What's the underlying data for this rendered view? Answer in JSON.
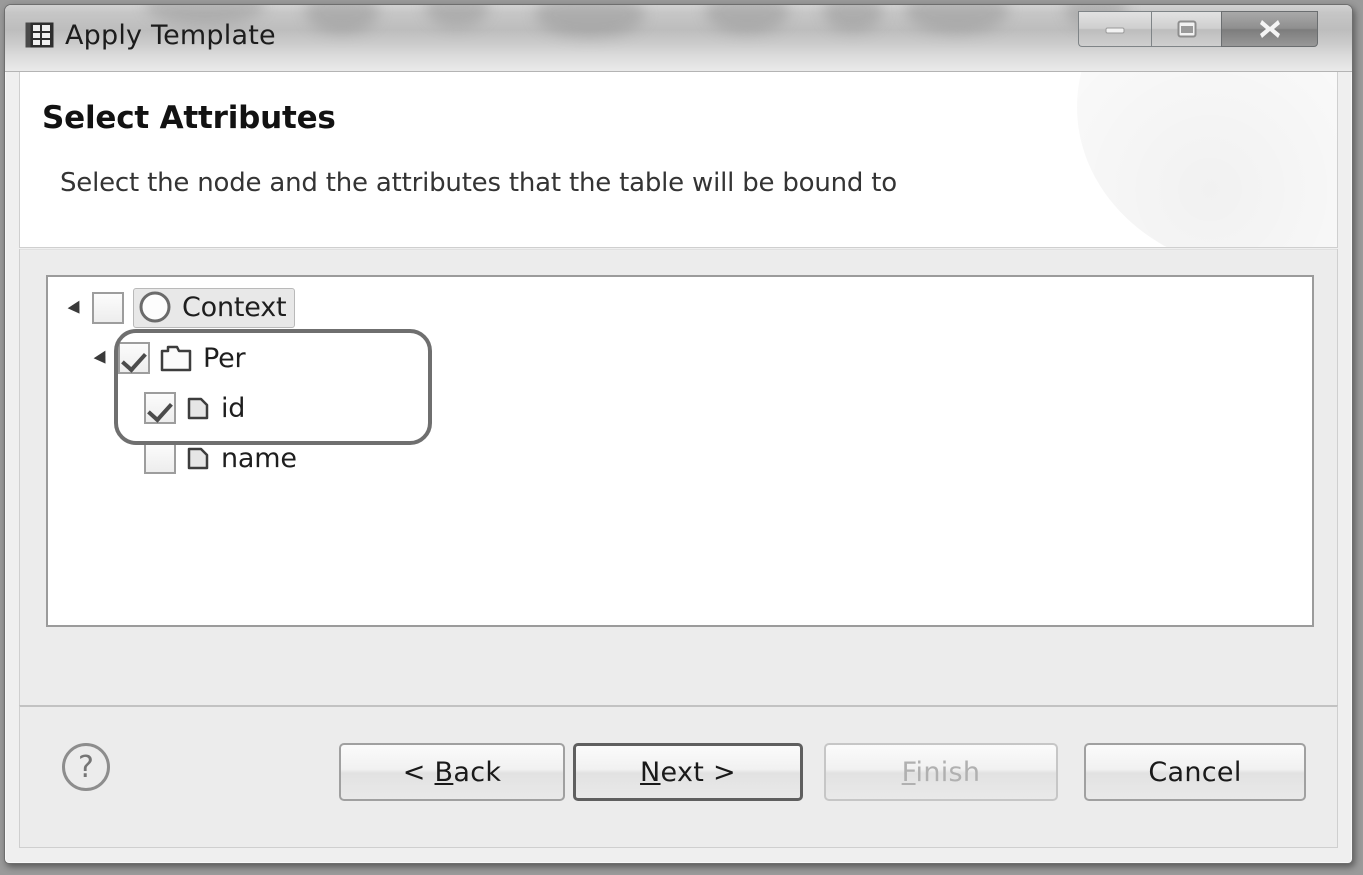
{
  "window": {
    "title": "Apply Template",
    "icon": "template-grid-icon",
    "controls": [
      {
        "name": "minimize-button",
        "glyph": "minimize-icon"
      },
      {
        "name": "maximize-button",
        "glyph": "maximize-icon"
      },
      {
        "name": "close-button",
        "glyph": "close-icon"
      }
    ]
  },
  "header": {
    "title": "Select Attributes",
    "description": "Select the node and the attributes that the table will be bound to"
  },
  "tree": {
    "items": [
      {
        "label": "Context",
        "icon": "context-circle-icon",
        "checked": false,
        "expanded": true,
        "selected": true,
        "indent": 0
      },
      {
        "label": "Per",
        "icon": "folder-node-icon",
        "checked": true,
        "expanded": true,
        "selected": false,
        "indent": 1
      },
      {
        "label": "id",
        "icon": "attribute-icon",
        "checked": true,
        "expanded": false,
        "selected": false,
        "indent": 2
      },
      {
        "label": "name",
        "icon": "attribute-icon",
        "checked": false,
        "expanded": false,
        "selected": false,
        "indent": 2
      }
    ]
  },
  "footer": {
    "help_label": "?",
    "buttons": [
      {
        "name": "back-button",
        "label": "< Back",
        "mnemonic": "B",
        "state": "enabled"
      },
      {
        "name": "next-button",
        "label": "Next >",
        "mnemonic": "N",
        "state": "default"
      },
      {
        "name": "finish-button",
        "label": "Finish",
        "mnemonic": "F",
        "state": "disabled"
      },
      {
        "name": "cancel-button",
        "label": "Cancel",
        "mnemonic": "",
        "state": "enabled"
      }
    ]
  },
  "colors": {
    "window_bg": "#efefef",
    "content_bg": "#ececec",
    "header_bg": "#ffffff",
    "tree_bg": "#ffffff",
    "tree_border": "#9b9b9b",
    "annotation_border": "#6f6f6f",
    "selection_bg": "#e8e8e8",
    "text": "#1e1e1e",
    "disabled_text": "#b0b0b0"
  }
}
